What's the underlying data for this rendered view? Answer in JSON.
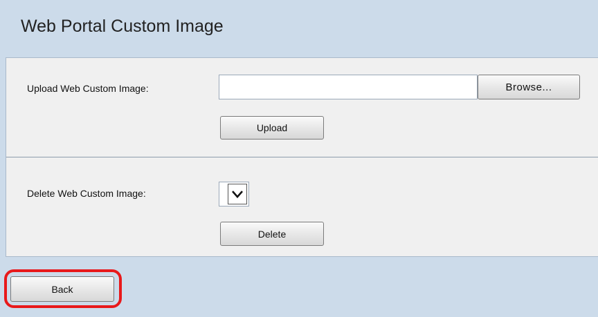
{
  "page": {
    "title": "Web Portal Custom Image"
  },
  "upload": {
    "label": "Upload Web Custom Image:",
    "file_value": "",
    "browse_label": "Browse...",
    "upload_label": "Upload"
  },
  "delete": {
    "label": "Delete Web Custom Image:",
    "selected_value": "",
    "delete_label": "Delete"
  },
  "footer": {
    "back_label": "Back"
  },
  "colors": {
    "page_background": "#ccdbea",
    "panel_background": "#f0f0f0",
    "highlight": "#e8191b"
  },
  "icons": {
    "dropdown": "chevron-down-icon"
  }
}
